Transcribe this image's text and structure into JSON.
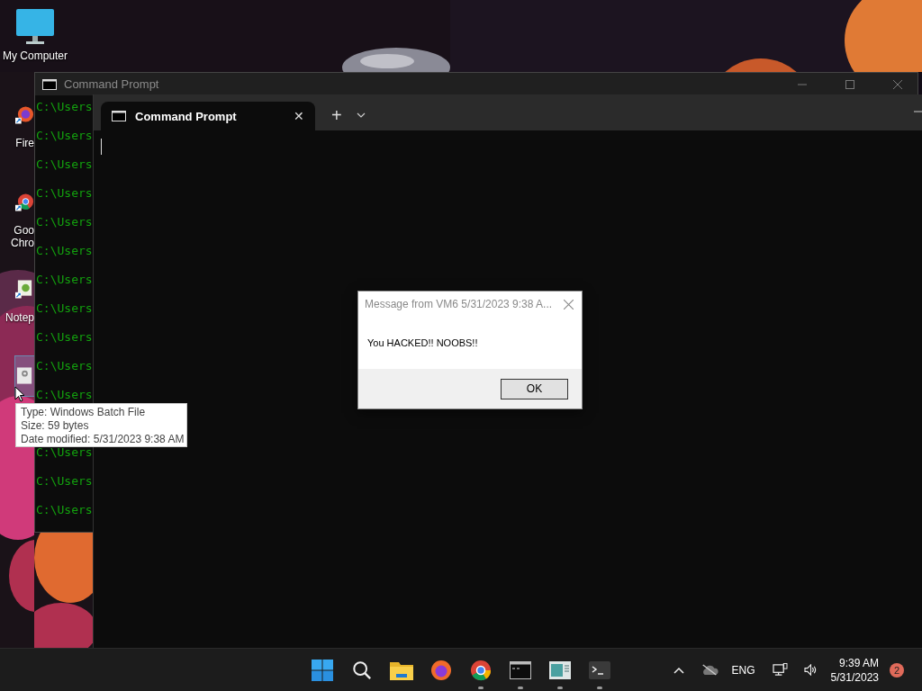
{
  "desktop_icons": [
    {
      "kind": "monitor",
      "label": "My Computer",
      "selected": false
    },
    {
      "kind": "firefox",
      "label": "Fire",
      "selected": false
    },
    {
      "kind": "chrome",
      "label": "Goo Chro",
      "selected": false
    },
    {
      "kind": "notepad",
      "label": "Notep",
      "selected": false
    },
    {
      "kind": "batch",
      "selected": true
    }
  ],
  "cmd_window": {
    "title": "Command Prompt",
    "lines": [
      "C:\\Users",
      "C:\\Users",
      "C:\\Users",
      "C:\\Users",
      "C:\\Users",
      "C:\\Users",
      "C:\\Users",
      "C:\\Users",
      "C:\\Users",
      "C:\\Users",
      "C:\\Users",
      "C:\\Users",
      "C:\\Users",
      "C:\\Users"
    ]
  },
  "terminal": {
    "tabs": [
      {
        "title": "Command Prompt",
        "selected": true,
        "close": "✕"
      }
    ],
    "new_tab": "+"
  },
  "dialog": {
    "title": "Message from VM6 5/31/2023 9:38 A...",
    "message": "You HACKED!! NOOBS!!",
    "button": "OK"
  },
  "tooltip": {
    "lines": [
      "Type: Windows Batch File",
      "Size: 59 bytes",
      "Date modified: 5/31/2023 9:38 AM"
    ]
  },
  "taskbar": {
    "apps": [
      {
        "kind": "start",
        "running": false
      },
      {
        "kind": "search",
        "running": false
      },
      {
        "kind": "folder",
        "running": false
      },
      {
        "kind": "firefox",
        "running": false
      },
      {
        "kind": "chrome",
        "running": true
      },
      {
        "kind": "cmd",
        "running": true
      },
      {
        "kind": "notepad",
        "running": true
      },
      {
        "kind": "terminal",
        "running": true
      }
    ],
    "language": "ENG",
    "time": "9:39 AM",
    "date": "5/31/2023",
    "notifications": "2"
  }
}
